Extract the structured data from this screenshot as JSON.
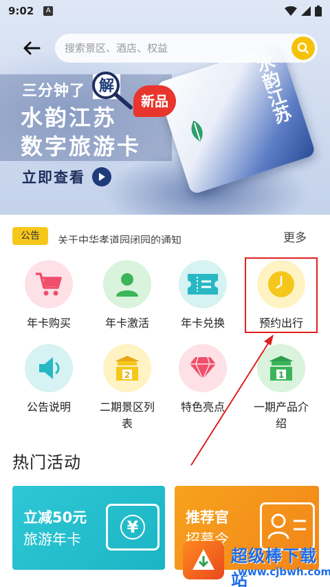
{
  "status_bar": {
    "time": "9:02",
    "a_icon": "A",
    "wifi_icon": "wifi-icon",
    "signal_icon": "signal-icon",
    "battery_icon": "battery-icon"
  },
  "header": {
    "back_icon": "back-arrow-icon",
    "search_placeholder": "搜索景区、酒店、权益",
    "search_icon": "search-icon"
  },
  "hero": {
    "line1_prefix": "三分钟了",
    "line1_highlight": "解",
    "title_line1": "水韵江苏",
    "title_line2": "数字旅游卡",
    "badge": "新品",
    "card_text": "水韵江苏",
    "view_now": "立即查看"
  },
  "notice": {
    "tag": "公告",
    "text": "关于中华孝道园闭园的通知",
    "more": "更多"
  },
  "grid": {
    "items": [
      {
        "label": "年卡购买",
        "icon": "cart-icon",
        "bg": "#fde1e6"
      },
      {
        "label": "年卡激活",
        "icon": "user-icon",
        "bg": "#d9f3dc"
      },
      {
        "label": "年卡兑换",
        "icon": "ticket-icon",
        "bg": "#d6f2f3"
      },
      {
        "label": "预约出行",
        "icon": "clock-icon",
        "bg": "#fff3c4"
      },
      {
        "label": "公告说明",
        "icon": "speaker-icon",
        "bg": "#d6f2f3"
      },
      {
        "label": "二期景区列表",
        "label_line1": "二期景区列",
        "label_line2": "表",
        "icon": "gate-2-icon",
        "bg": "#fff3c4"
      },
      {
        "label": "特色亮点",
        "icon": "diamond-icon",
        "bg": "#fde1e6"
      },
      {
        "label": "一期产品介绍",
        "label_line1": "一期产品介",
        "label_line2": "绍",
        "icon": "gate-1-icon",
        "bg": "#d9f3dc"
      }
    ]
  },
  "hot": {
    "title": "热门活动",
    "promo1": {
      "line1": "立减50元",
      "line2": "旅游年卡",
      "icon": "coupon-icon",
      "color": "#2fc7d6"
    },
    "promo2": {
      "line1": "推荐官",
      "line2": "招募令",
      "icon": "id-card-icon",
      "color": "#f7a21d"
    }
  },
  "watermark": {
    "title": "超级棒下载站",
    "url": "www.cjbwh.com"
  },
  "colors": {
    "accent": "#f5c20a",
    "annotation": "#e02020"
  }
}
